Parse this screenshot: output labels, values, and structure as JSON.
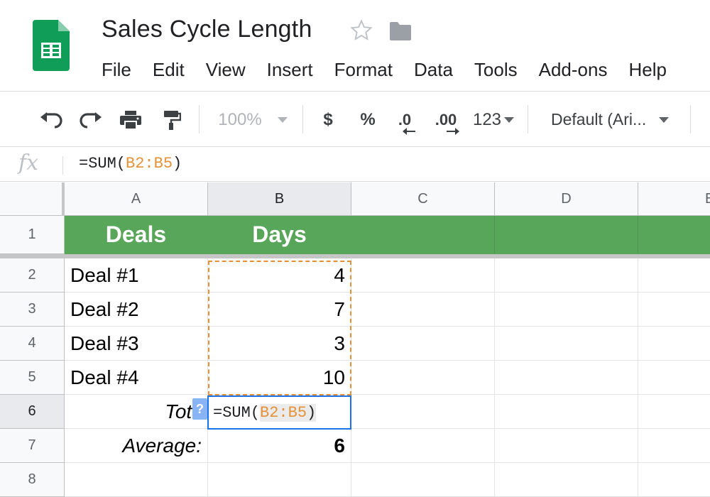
{
  "document": {
    "title": "Sales Cycle Length"
  },
  "menu": [
    "File",
    "Edit",
    "View",
    "Insert",
    "Format",
    "Data",
    "Tools",
    "Add-ons",
    "Help"
  ],
  "toolbar": {
    "zoom": "100%",
    "currency": "$",
    "percent": "%",
    "decrease_decimal": ".0",
    "increase_decimal": ".00",
    "number_format": "123",
    "font": "Default (Ari..."
  },
  "formula_bar": {
    "fx": "fx",
    "prefix": "=SUM(",
    "range": "B2:B5",
    "suffix": ")"
  },
  "columns": [
    "A",
    "B",
    "C",
    "D",
    "E"
  ],
  "rows": [
    "1",
    "2",
    "3",
    "4",
    "5",
    "6",
    "7",
    "8"
  ],
  "sheet": {
    "header": {
      "a": "Deals",
      "b": "Days"
    },
    "deals": [
      {
        "name": "Deal #1",
        "days": "4"
      },
      {
        "name": "Deal #2",
        "days": "7"
      },
      {
        "name": "Deal #3",
        "days": "3"
      },
      {
        "name": "Deal #4",
        "days": "10"
      }
    ],
    "total_label": "Total",
    "average_label": "Average:",
    "average_value": "6"
  },
  "editing": {
    "help": "?",
    "prefix": "=SUM(",
    "range": "B2:B5",
    "suffix": ")"
  },
  "colors": {
    "header_green": "#57a65a",
    "range_orange": "#e69138",
    "active_blue": "#1a73e8"
  }
}
